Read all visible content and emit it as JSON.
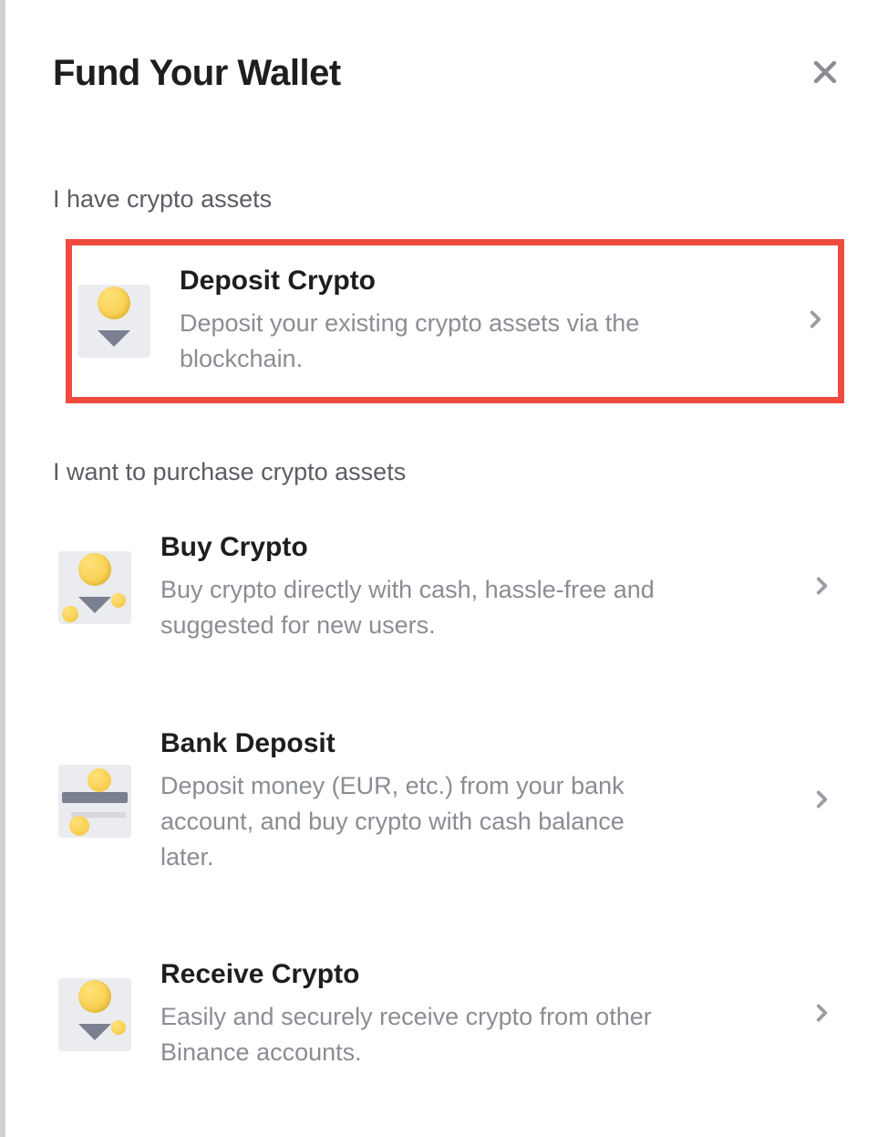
{
  "header": {
    "title": "Fund Your Wallet"
  },
  "sections": [
    {
      "label": "I have crypto assets",
      "options": [
        {
          "id": "deposit-crypto",
          "title": "Deposit Crypto",
          "description": "Deposit your existing crypto assets via the blockchain.",
          "highlighted": true
        }
      ]
    },
    {
      "label": "I want to purchase crypto assets",
      "options": [
        {
          "id": "buy-crypto",
          "title": "Buy Crypto",
          "description": "Buy crypto directly with cash, hassle-free and suggested for new users."
        },
        {
          "id": "bank-deposit",
          "title": "Bank Deposit",
          "description": "Deposit money (EUR, etc.) from your bank account, and buy crypto with cash balance later."
        },
        {
          "id": "receive-crypto",
          "title": "Receive Crypto",
          "description": "Easily and securely receive crypto from other Binance accounts."
        }
      ]
    }
  ]
}
